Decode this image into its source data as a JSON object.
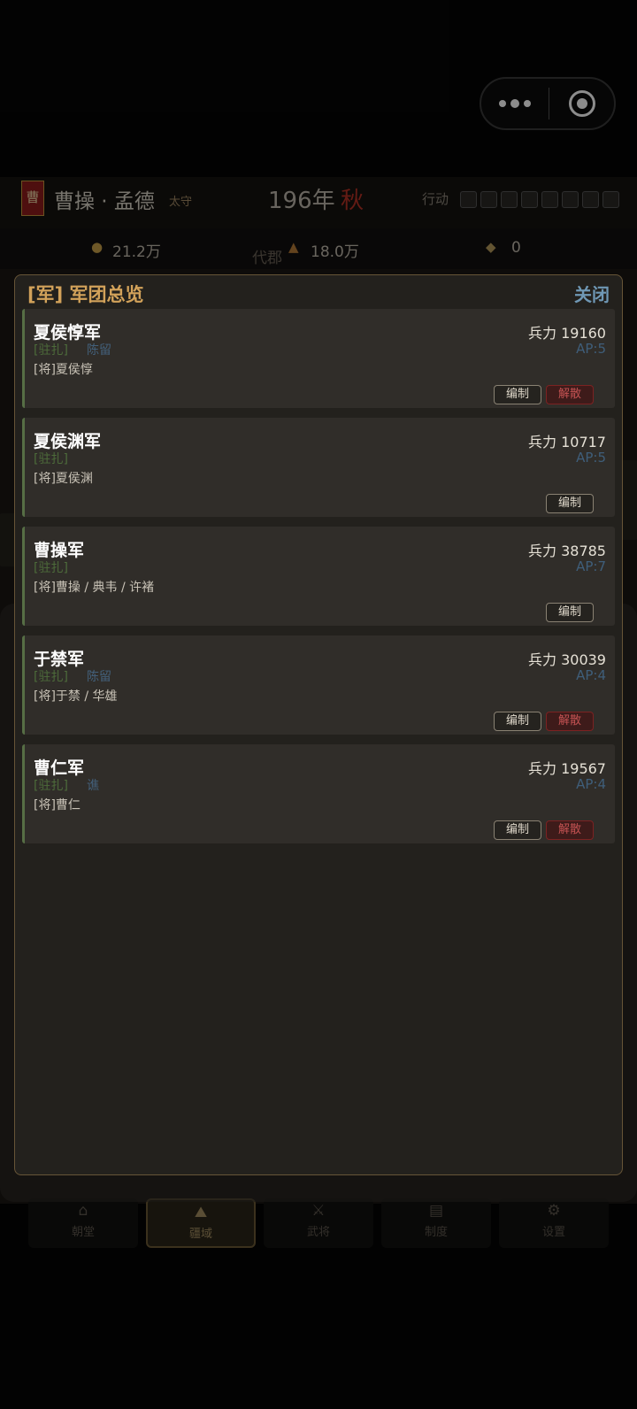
{
  "capsule": {
    "more_icon": "more-dots-icon",
    "close_icon": "target-close-icon"
  },
  "header": {
    "banner": "曹",
    "ruler": "曹操 · 孟德",
    "title": "太守",
    "year": "196年",
    "season": "秋",
    "action_label": "行动",
    "action_slots": 8
  },
  "resources": {
    "gold_icon": "gold-icon",
    "gold": "21.2万",
    "place": "代郡",
    "food_icon": "food-icon",
    "food": "18.0万",
    "horse_icon": "horse-icon",
    "horse": "0"
  },
  "dialog": {
    "title": "[军] 军团总览",
    "close": "关闭",
    "edit_label": "编制",
    "disband_label": "解散",
    "armies": [
      {
        "name": "夏侯惇军",
        "status": "[驻扎]",
        "location": "陈留",
        "generals": "[将]夏侯惇",
        "troops": "兵力 19160",
        "ap": "AP:5",
        "can_disband": true
      },
      {
        "name": "夏侯渊军",
        "status": "[驻扎]",
        "location": "",
        "generals": "[将]夏侯渊",
        "troops": "兵力 10717",
        "ap": "AP:5",
        "can_disband": false
      },
      {
        "name": "曹操军",
        "status": "[驻扎]",
        "location": "",
        "generals": "[将]曹操 / 典韦 / 许褚",
        "troops": "兵力 38785",
        "ap": "AP:7",
        "can_disband": false
      },
      {
        "name": "于禁军",
        "status": "[驻扎]",
        "location": "陈留",
        "generals": "[将]于禁 / 华雄",
        "troops": "兵力 30039",
        "ap": "AP:4",
        "can_disband": true
      },
      {
        "name": "曹仁军",
        "status": "[驻扎]",
        "location": "谯",
        "generals": "[将]曹仁",
        "troops": "兵力 19567",
        "ap": "AP:4",
        "can_disband": true
      }
    ]
  },
  "nav": [
    {
      "label": "朝堂",
      "icon": "court-icon",
      "active": false
    },
    {
      "label": "疆域",
      "icon": "territory-icon",
      "active": true
    },
    {
      "label": "武将",
      "icon": "general-icon",
      "active": false
    },
    {
      "label": "制度",
      "icon": "system-icon",
      "active": false
    },
    {
      "label": "设置",
      "icon": "settings-icon",
      "active": false
    }
  ]
}
